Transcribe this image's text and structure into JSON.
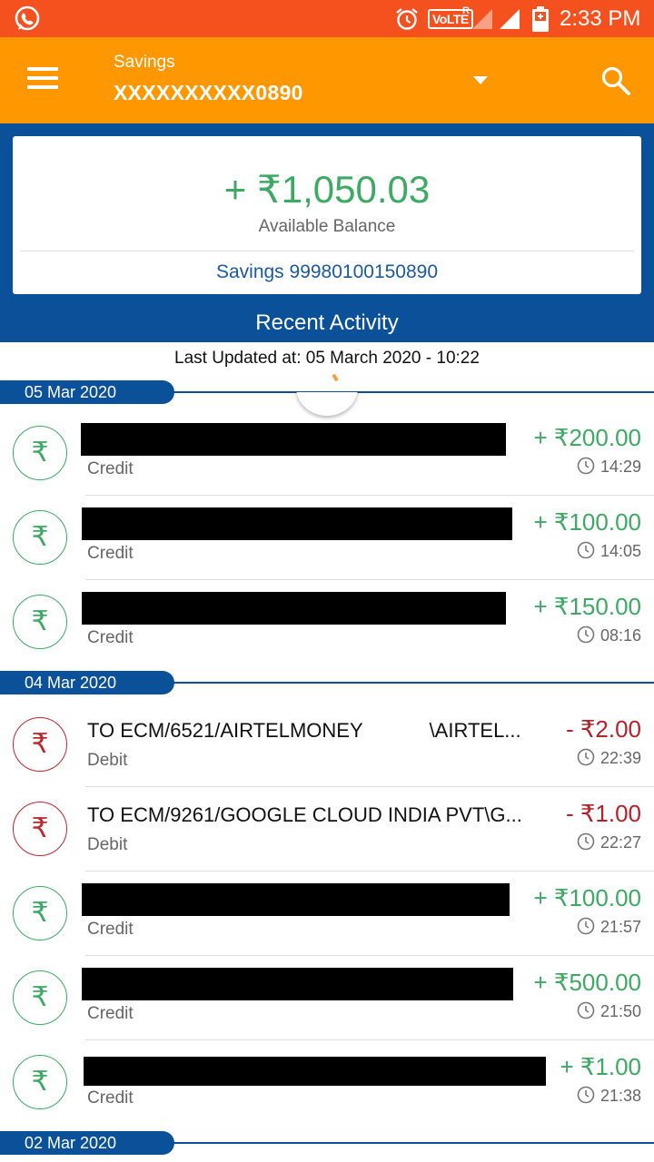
{
  "status_bar": {
    "volte": "VoLTE",
    "volte_r": "R",
    "time": "2:33 PM"
  },
  "app_bar": {
    "account_type": "Savings",
    "account_number": "XXXXXXXXXX0890"
  },
  "balance": {
    "amount": "+ ₹1,050.03",
    "label": "Available Balance",
    "account": "Savings 99980100150890"
  },
  "recent_activity": {
    "title": "Recent Activity",
    "last_updated": "Last Updated at: 05 March 2020 - 10:22"
  },
  "groups": [
    {
      "date": "05 Mar 2020",
      "transactions": [
        {
          "description": "",
          "type": "Credit",
          "amount": "+ ₹200.00",
          "time": "14:29",
          "kind": "credit"
        },
        {
          "description": "",
          "type": "Credit",
          "amount": "+ ₹100.00",
          "time": "14:05",
          "kind": "credit"
        },
        {
          "description": "",
          "type": "Credit",
          "amount": "+ ₹150.00",
          "time": "08:16",
          "kind": "credit"
        }
      ]
    },
    {
      "date": "04 Mar 2020",
      "transactions": [
        {
          "description": "TO ECM/6521/AIRTELMONEY            \\AIRTEL...",
          "type": "Debit",
          "amount": "- ₹2.00",
          "time": "22:39",
          "kind": "debit"
        },
        {
          "description": "TO ECM/9261/GOOGLE CLOUD INDIA PVT\\G...",
          "type": "Debit",
          "amount": "- ₹1.00",
          "time": "22:27",
          "kind": "debit"
        },
        {
          "description": "",
          "type": "Credit",
          "amount": "+ ₹100.00",
          "time": "21:57",
          "kind": "credit"
        },
        {
          "description": "",
          "type": "Credit",
          "amount": "+ ₹500.00",
          "time": "21:50",
          "kind": "credit"
        },
        {
          "description": "",
          "type": "Credit",
          "amount": "+ ₹1.00",
          "time": "21:38",
          "kind": "credit"
        }
      ]
    },
    {
      "date": "02 Mar 2020",
      "transactions": []
    }
  ],
  "icons": {
    "rupee": "₹"
  },
  "colors": {
    "status_bar": "#f4511e",
    "app_bar": "#ff9800",
    "brand_blue": "#0b519a",
    "credit_green": "#3daa63",
    "debit_red": "#b5222a"
  }
}
